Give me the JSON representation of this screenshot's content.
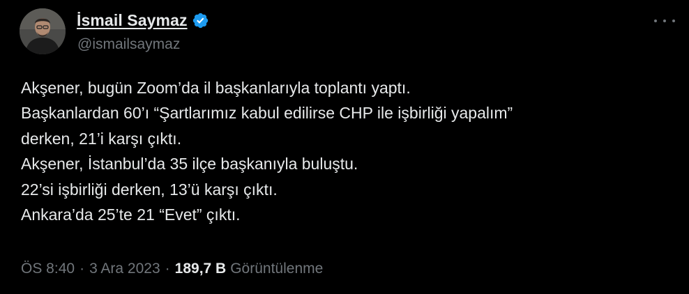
{
  "author": {
    "display_name": "İsmail Saymaz",
    "handle": "@ismailsaymaz",
    "verified": true,
    "verified_color": "#1d9bf0"
  },
  "tweet": {
    "lines": [
      "Akşener, bugün Zoom’da il başkanlarıyla toplantı yaptı.",
      "Başkanlardan 60’ı “Şartlarımız kabul edilirse CHP ile işbirliği yapalım”",
      "derken, 21’i karşı çıktı.",
      "Akşener, İstanbul’da 35 ilçe başkanıyla buluştu.",
      "22’si işbirliği derken, 13’ü karşı çıktı.",
      "Ankara’da 25’te 21 “Evet” çıktı."
    ]
  },
  "meta": {
    "time": "ÖS 8:40",
    "separator": "·",
    "date": "3 Ara 2023",
    "views_count": "189,7 B",
    "views_label": "Görüntülenme"
  },
  "icons": {
    "verified": "verified-badge-icon",
    "more": "more-options-icon"
  },
  "colors": {
    "background": "#000000",
    "primary_text": "#e7e9ea",
    "secondary_text": "#71767b"
  }
}
